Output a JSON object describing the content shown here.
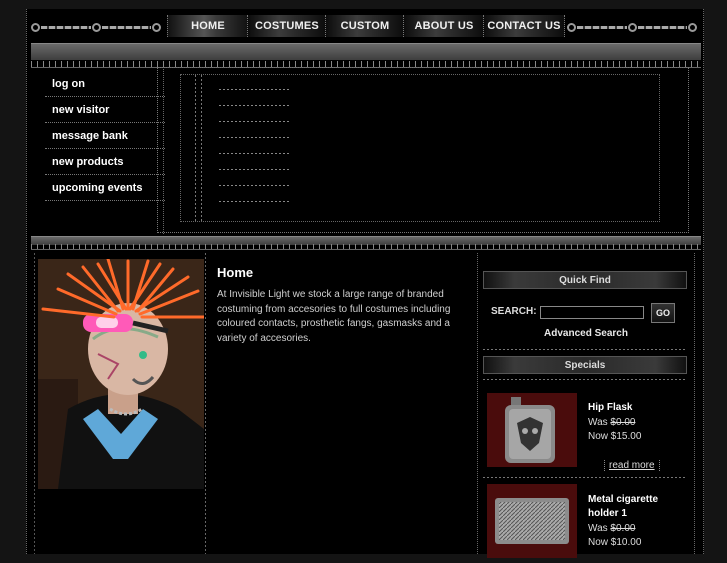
{
  "nav": {
    "tabs": [
      {
        "label": "HOME"
      },
      {
        "label": "COSTUMES"
      },
      {
        "label": "CUSTOM"
      },
      {
        "label": "ABOUT US"
      },
      {
        "label": "CONTACT US"
      }
    ]
  },
  "sidebar": {
    "items": [
      {
        "label": "log on"
      },
      {
        "label": "new visitor"
      },
      {
        "label": "message bank"
      },
      {
        "label": "new products"
      },
      {
        "label": "upcoming events"
      }
    ]
  },
  "main": {
    "title": "Home",
    "body": "At Invisible Light we stock a large range of branded costuming from accesories to full costumes including coloured contacts, prosthetic fangs, gasmasks and a variety of accesories."
  },
  "quickfind": {
    "header": "Quick Find",
    "search_label": "SEARCH:",
    "search_value": "",
    "go_label": "GO",
    "advanced_label": "Advanced Search"
  },
  "specials": {
    "header": "Specials",
    "products": [
      {
        "name": "Hip Flask",
        "was_label": "Was",
        "was_price": "$0.00",
        "now_label": "Now",
        "now_price": "$15.00",
        "read_more": "read more"
      },
      {
        "name": "Metal cigarette holder 1",
        "was_label": "Was",
        "was_price": "$0.00",
        "now_label": "Now",
        "now_price": "$10.00"
      }
    ]
  },
  "colors": {
    "background": "#000000",
    "frame": "#141414",
    "bar": "#5a5a5a"
  }
}
